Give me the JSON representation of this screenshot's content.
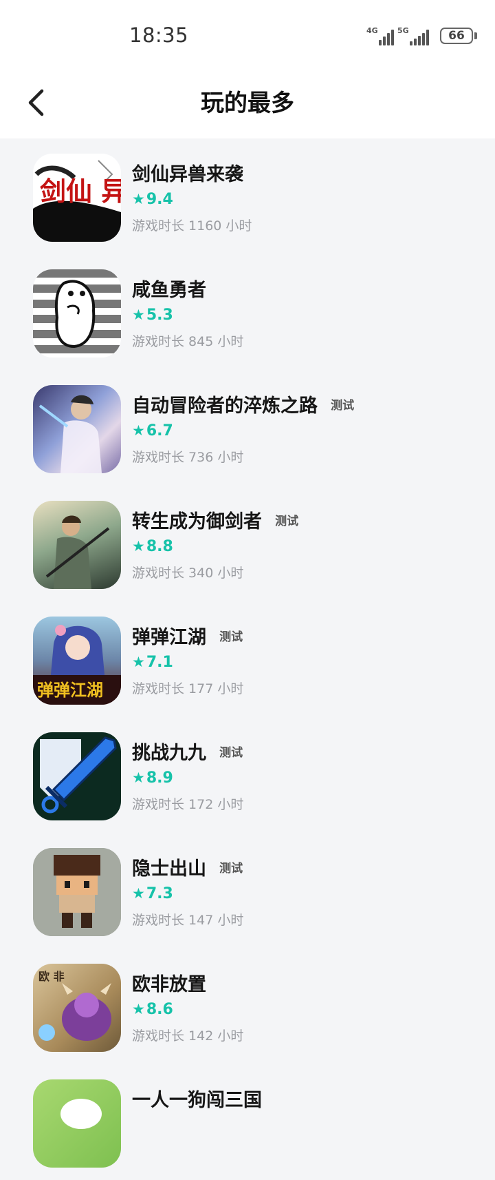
{
  "status": {
    "time": "18:35",
    "signal1": "4G",
    "signal2": "5G",
    "battery": "66"
  },
  "header": {
    "title": "玩的最多"
  },
  "games": [
    {
      "name": "剑仙异兽来袭",
      "tag": "",
      "rating": "9.4",
      "playtime": "游戏时长 1160 小时",
      "icon": "ink-calligraphy-icon",
      "icon_text": "剑仙 异兽来袭"
    },
    {
      "name": "咸鱼勇者",
      "tag": "",
      "rating": "5.3",
      "playtime": "游戏时长 845 小时",
      "icon": "salted-fish-icon"
    },
    {
      "name": "自动冒险者的淬炼之路",
      "tag": "测试",
      "rating": "6.7",
      "playtime": "游戏时长 736 小时",
      "icon": "swordsman-portrait-icon"
    },
    {
      "name": "转生成为御剑者",
      "tag": "测试",
      "rating": "8.8",
      "playtime": "游戏时长 340 小时",
      "icon": "sword-master-portrait-icon"
    },
    {
      "name": "弹弹江湖",
      "tag": "测试",
      "rating": "7.1",
      "playtime": "游戏时长 177 小时",
      "icon": "anime-girl-icon",
      "icon_text": "弹弹江湖"
    },
    {
      "name": "挑战九九",
      "tag": "测试",
      "rating": "8.9",
      "playtime": "游戏时长 172 小时",
      "icon": "crossed-swords-icon"
    },
    {
      "name": "隐士出山",
      "tag": "测试",
      "rating": "7.3",
      "playtime": "游戏时长 147 小时",
      "icon": "pixel-hero-icon"
    },
    {
      "name": "欧非放置",
      "tag": "",
      "rating": "8.6",
      "playtime": "游戏时长 142 小时",
      "icon": "monster-icon",
      "icon_text": "欧 非"
    },
    {
      "name": "一人一狗闯三国",
      "tag": "",
      "rating": "",
      "playtime": "",
      "icon": "dog-icon"
    }
  ],
  "colors": {
    "accent": "#16c2a9",
    "background": "#f4f5f7",
    "muted": "#9a9ca1"
  }
}
